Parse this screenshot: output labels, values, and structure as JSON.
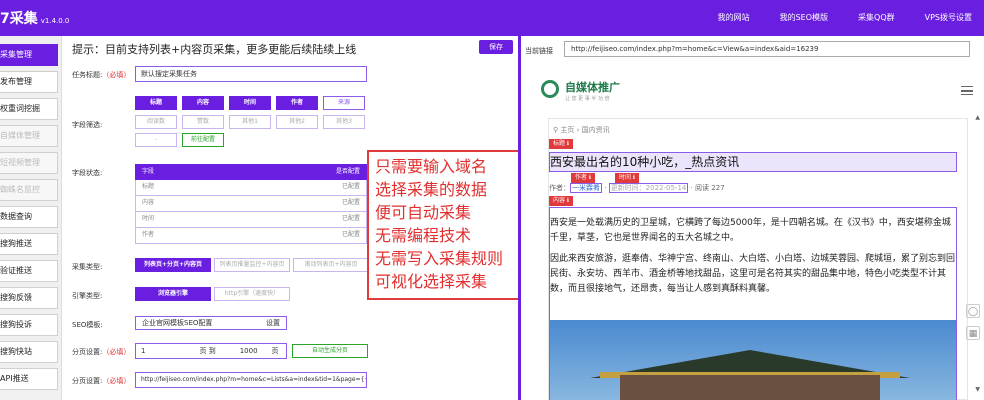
{
  "topbar": {
    "title": "7采集",
    "version": "v1.4.0.0",
    "nav": [
      "我的网站",
      "我的SEO模版",
      "采集QQ群",
      "VPS拨号设置"
    ]
  },
  "sidebar": {
    "items": [
      {
        "label": "采集管理",
        "state": "active"
      },
      {
        "label": "发布管理",
        "state": "normal"
      },
      {
        "label": "权重词挖掘",
        "state": "normal"
      },
      {
        "label": "自媒体管理",
        "state": "disabled"
      },
      {
        "label": "短视频管理",
        "state": "disabled"
      },
      {
        "label": "蜘蛛名监控",
        "state": "disabled"
      },
      {
        "label": "数据查询",
        "state": "normal"
      },
      {
        "label": "搜狗推送",
        "state": "normal"
      },
      {
        "label": "验证推送",
        "state": "normal"
      },
      {
        "label": "搜狗反馈",
        "state": "normal"
      },
      {
        "label": "搜狗投诉",
        "state": "normal"
      },
      {
        "label": "搜狗快站",
        "state": "normal"
      },
      {
        "label": "API推送",
        "state": "normal"
      }
    ]
  },
  "config": {
    "hint": "提示：目前支持列表+内容页采集，更多更能后续陆续上线",
    "save_label": "保存",
    "required": "（必填）",
    "task_title_label": "任务标题:",
    "task_title_value": "默认搜定采集任务",
    "field_filter_label": "字段筛选:",
    "chips_row1": [
      "标题",
      "内容",
      "时间",
      "作者",
      "来源"
    ],
    "chips_row2": [
      "阅读数",
      "赞数",
      "其他1",
      "其他2",
      "其他3"
    ],
    "chip_minus": "-",
    "chip_front": "前往配置",
    "field_status_label": "字段状态:",
    "field_table": {
      "head_left": "字段",
      "head_right": "是否配置",
      "rows": [
        {
          "name": "标题",
          "status": "已配置"
        },
        {
          "name": "内容",
          "status": "已配置"
        },
        {
          "name": "时间",
          "status": "已配置"
        },
        {
          "name": "作者",
          "status": "已配置"
        }
      ]
    },
    "collect_type_label": "采集类型:",
    "collect_types": [
      "列表页+分页+内容页",
      "列表页推量监控+内容页",
      "滚动列表页+内容页"
    ],
    "engine_label": "引擎类型:",
    "engines": [
      "浏览器引擎",
      "http引擎（速度快）"
    ],
    "seo_label": "SEO模板:",
    "seo_value": "企业官网模板SEO配置",
    "seo_set": "设置",
    "pagination_label": "分页设置:",
    "page_from": "1",
    "page_to_label": "页 到",
    "page_to": "1000",
    "page_unit": "页",
    "auto_gen": "自动生成分页",
    "pagination_url_label": "分页设置:",
    "pagination_url": "http://feijiseo.com/index.php?m=home&c=Lists&a=index&tid=1&page={{}}分页"
  },
  "annotation": {
    "lines": [
      "只需要输入域名",
      "选择采集的数据",
      "便可自动采集",
      "无需编程技术",
      "无需写入采集规则",
      "可视化选择采集"
    ]
  },
  "preview": {
    "url_label": "当前链接",
    "url": "http://feijiseo.com/index.php?m=home&c=View&a=index&aid=16239",
    "logo_text": "自媒体推广",
    "logo_sub": "让 您 更 事 半 功 倍",
    "breadcrumb": "主页 ›  国内资讯",
    "tag_title": "标题 ℹ",
    "tag_author": "作者 ℹ",
    "tag_time": "时间 ℹ",
    "tag_content": "内容 ℹ",
    "article_title": "西安最出名的10种小吃，_热点资讯",
    "meta_author_label": "作者：",
    "meta_author": "一米霖肴",
    "meta_time": "更新时间：2022-05-14",
    "meta_views": "· 阅读 227",
    "paragraph1": "西安是一处载满历史的卫星城，它横跨了每边5000年，是十四朝名城。在《汉书》中，西安堪称金城千里，草茎，它也是世界闻名的五大名城之中。",
    "paragraph2": "因此来西安旅游，逛奉倩、华神宁宫、终南山、大白塔、小白塔、边城芙蓉园、爬城垣，累了别忘到回民街、永安坊、西羊市、酒金桥等地找甜品，这里可是名符其实的甜品集中地，特色小吃类型不计其数，而且很接地气，还昂贵，每当让人感到真酥料真馨。"
  },
  "colors": {
    "brand": "#6a1ee0",
    "annotation": "#e03a3a",
    "tag": "#e03a3a"
  }
}
